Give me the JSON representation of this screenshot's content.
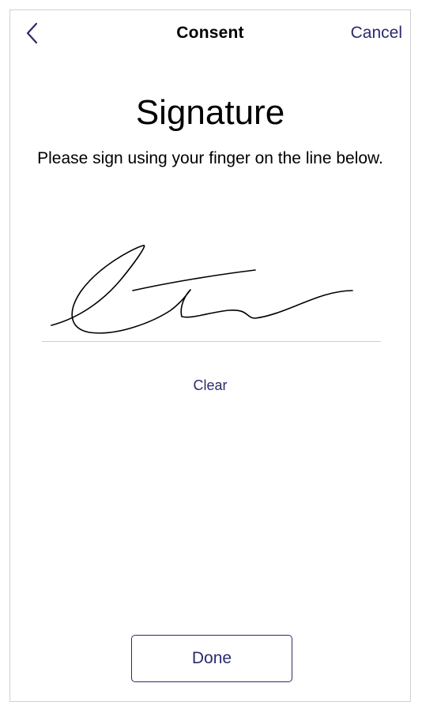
{
  "nav": {
    "title": "Consent",
    "cancel_label": "Cancel",
    "back_icon": "chevron-left-icon"
  },
  "content": {
    "heading": "Signature",
    "instructions": "Please sign using your finger on the line below."
  },
  "signature": {
    "has_signature": true,
    "clear_label": "Clear"
  },
  "footer": {
    "done_label": "Done"
  },
  "colors": {
    "accent": "#2b2a6b",
    "divider": "#cccccc",
    "frame_border": "#cfcfcf",
    "text": "#000000"
  }
}
